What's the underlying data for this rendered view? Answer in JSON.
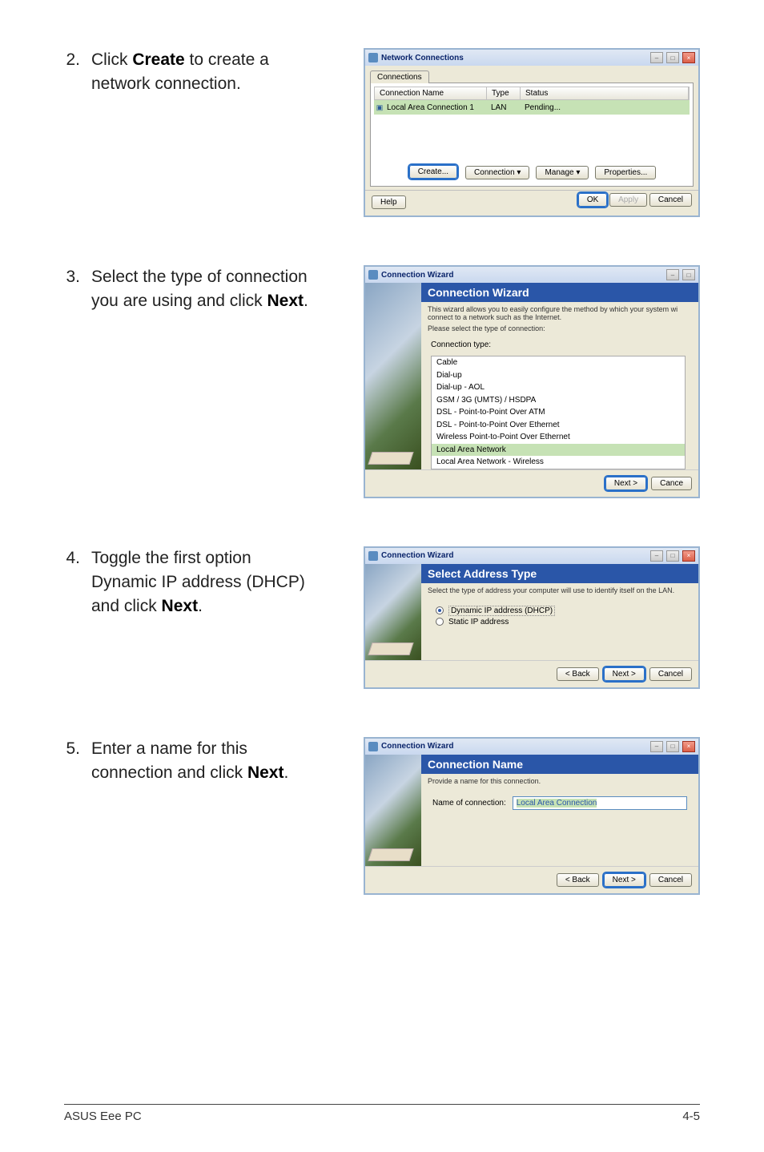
{
  "steps": {
    "s2": {
      "num": "2.",
      "pre": "Click ",
      "bold": "Create",
      "post": " to create a network connection."
    },
    "s3": {
      "num": "3.",
      "pre": "Select the type of connection you are using and click ",
      "bold": "Next",
      "post": "."
    },
    "s4": {
      "num": "4.",
      "pre": "Toggle the first option Dynamic IP address (DHCP) and click ",
      "bold": "Next",
      "post": "."
    },
    "s5": {
      "num": "5.",
      "pre": "Enter a name for this connection and click ",
      "bold": "Next",
      "post": "."
    }
  },
  "win2": {
    "title": "Network Connections",
    "tab": "Connections",
    "col_name": "Connection Name",
    "col_type": "Type",
    "col_status": "Status",
    "row_name": "Local Area Connection 1",
    "row_type": "LAN",
    "row_status": "Pending...",
    "btn_create": "Create...",
    "btn_connection": "Connection ▾",
    "btn_manage": "Manage ▾",
    "btn_properties": "Properties...",
    "btn_help": "Help",
    "btn_ok": "OK",
    "btn_apply": "Apply",
    "btn_cancel": "Cancel"
  },
  "win3": {
    "title": "Connection Wizard",
    "banner": "Connection Wizard",
    "sub1": "This wizard allows you to easily configure the method by which your system wi",
    "sub2": "connect to a network such as the Internet.",
    "sub3": "Please select the type of connection:",
    "label": "Connection type:",
    "opts": [
      "Cable",
      "Dial-up",
      "Dial-up - AOL",
      "GSM / 3G (UMTS) / HSDPA",
      "DSL - Point-to-Point Over ATM",
      "DSL - Point-to-Point Over Ethernet",
      "Wireless Point-to-Point Over Ethernet",
      "Local Area Network",
      "Local Area Network - Wireless"
    ],
    "next": "Next >",
    "cancel": "Cance"
  },
  "win4": {
    "title": "Connection Wizard",
    "banner": "Select Address Type",
    "sub": "Select the type of address your computer will use to identify itself on the LAN.",
    "opt1": "Dynamic IP address (DHCP)",
    "opt2": "Static IP address",
    "back": "< Back",
    "next": "Next >",
    "cancel": "Cancel"
  },
  "win5": {
    "title": "Connection Wizard",
    "banner": "Connection Name",
    "sub": "Provide a name for this connection.",
    "label": "Name of connection:",
    "value": "Local Area Connection",
    "back": "< Back",
    "next": "Next >",
    "cancel": "Cancel"
  },
  "footer": {
    "left": "ASUS Eee PC",
    "right": "4-5"
  }
}
